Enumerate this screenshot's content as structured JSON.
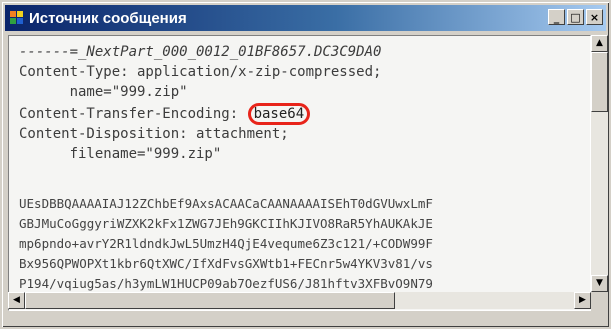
{
  "window": {
    "title": "Источник сообщения",
    "icon": "message-source-icon",
    "controls": {
      "minimize": "_",
      "maximize": "□",
      "close": "×"
    }
  },
  "source": {
    "headers": [
      "------=_NextPart_000_0012_01BF8657.DC3C9DA0",
      "Content-Type: application/x-zip-compressed;",
      "      name=\"999.zip\"",
      "Content-Transfer-Encoding: ",
      "Content-Disposition: attachment;",
      "      filename=\"999.zip\""
    ],
    "encoding_value": "base64",
    "encoded_lines": [
      "UEsDBBQAAAAIAJ12ZChbEf9AxsACAACaCAANAAAAISEhT0dGVUwxLmF",
      "GBJMuCoGggyriWZXK2kFx1ZWG7JEh9GKCIIhKJIVO8RaR5YhAUKAkJE",
      "mp6pndo+avrY2R1ldndkJwL5UmzH4QjE4vequme6Z3c121/+CODW99F",
      "Bx956QPWOPXt1kbr6QtXWC/IfXdFvsGXWtb1+FECnr5w4YKV3v81/vs",
      "P194/vqiug5as/h3ymLW1HUCP09ab7OezfUS6/J81hftv3XFBvO9N79"
    ]
  },
  "accent_color": "#e8241a"
}
